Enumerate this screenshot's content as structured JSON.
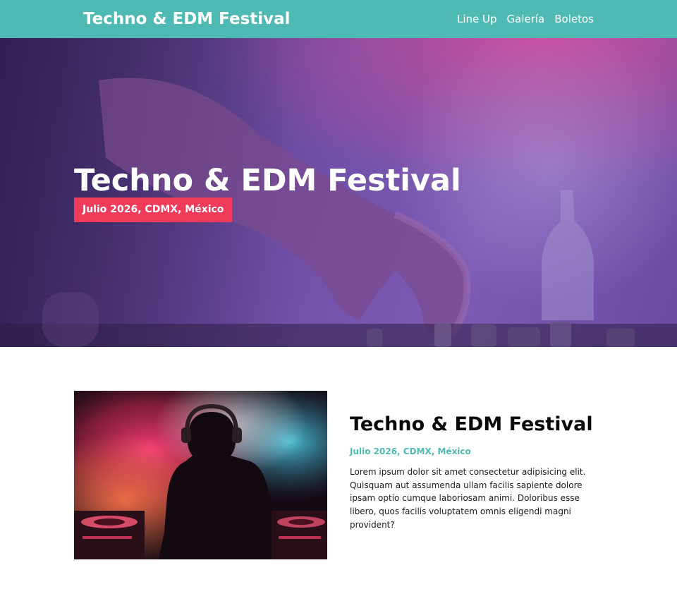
{
  "header": {
    "brand": "Techno & EDM Festival",
    "nav": [
      "Line Up",
      "Galería",
      "Boletos"
    ]
  },
  "hero": {
    "title": "Techno & EDM Festival",
    "badge": "Julio 2026, CDMX, México"
  },
  "about": {
    "title": "Techno & EDM Festival",
    "date": "Julio 2026, CDMX, México",
    "body": "Lorem ipsum dolor sit amet consectetur adipisicing elit. Quisquam aut assumenda ullam facilis sapiente dolore ipsam optio cumque laboriosam animi. Doloribus esse libero, quos facilis voluptatem omnis eligendi magni provident?"
  },
  "colors": {
    "header_bg": "#4fb9b3",
    "badge_bg": "#f03b5a",
    "accent_text": "#4fb9b3",
    "hero_overlay": "#6f4fa6"
  },
  "images": {
    "hero": "dj-hand-on-mixer-photo",
    "about": "dj-with-headphones-smoke-photo"
  }
}
